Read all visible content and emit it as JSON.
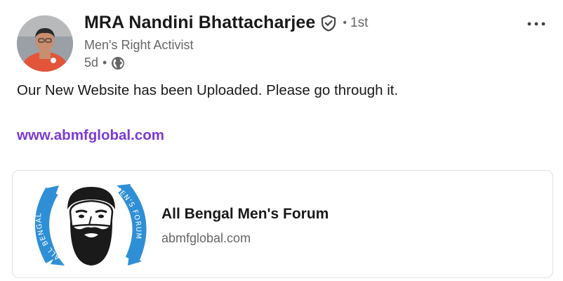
{
  "author": {
    "name": "MRA Nandini Bhattacharjee",
    "degree": "1st",
    "headline": "Men's Right Activist",
    "time": "5d",
    "visibility_icon": "globe-icon",
    "verified_icon": "verified-shield-icon"
  },
  "post": {
    "text": "Our New Website has been Uploaded. Please go through it.",
    "link_text": "www.abmfglobal.com"
  },
  "preview_card": {
    "title": "All Bengal Men's Forum",
    "domain": "abmfglobal.com",
    "logo_text_left": "ALL BENGAL",
    "logo_text_right": "MEN'S FORUM"
  },
  "colors": {
    "link": "#7b3ad6",
    "secondary_text": "#666666",
    "logo_blue": "#2f8fd6"
  }
}
